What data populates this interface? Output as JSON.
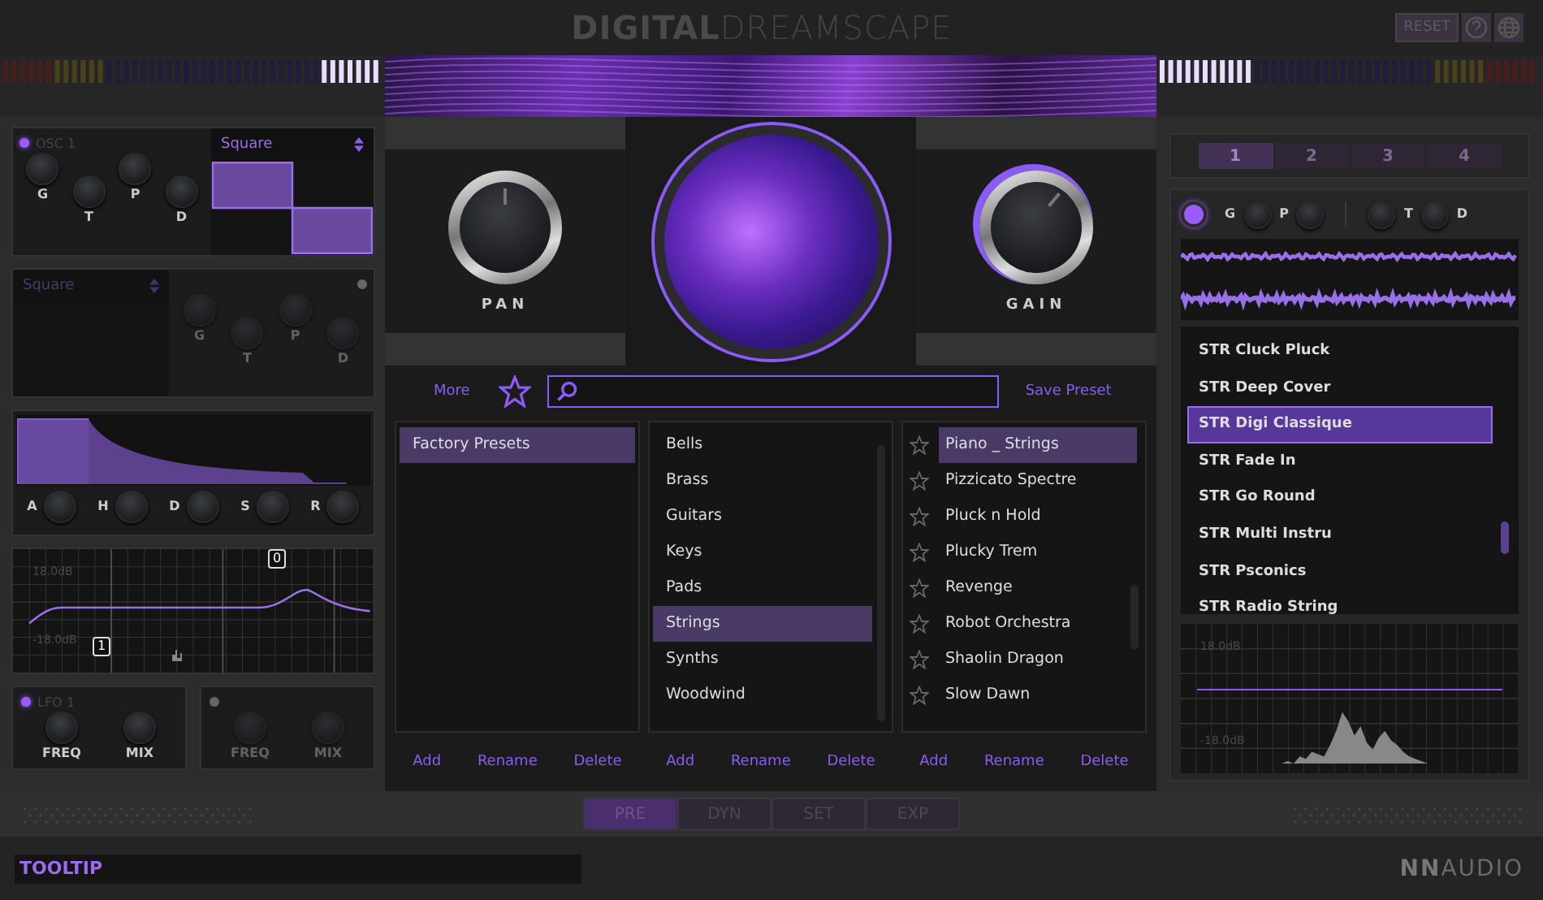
{
  "header": {
    "title": "**DIGITAL**DREAMSCAPE",
    "reset": "RESET"
  },
  "meters": [
    {
      "level": 0.16
    },
    {
      "level": 0.25
    }
  ],
  "osc1": {
    "title": "OSC 1",
    "on": true,
    "waveform": "Square",
    "knobs": [
      "G",
      "T",
      "P",
      "D"
    ]
  },
  "osc2": {
    "on": false,
    "waveform": "Square",
    "knobs": [
      "G",
      "T",
      "P",
      "D"
    ]
  },
  "envelope": {
    "knobs": [
      "A",
      "H",
      "D",
      "S",
      "R"
    ]
  },
  "eq": {
    "top_label": "18.0dB",
    "bottom_label": "-18.0dB",
    "bands": [
      "0",
      "1"
    ]
  },
  "lfos": [
    {
      "title": "LFO 1",
      "on": true,
      "knobs": [
        "FREQ",
        "MIX"
      ]
    },
    {
      "on": false,
      "knobs": [
        "FREQ",
        "MIX"
      ]
    }
  ],
  "main_knobs": {
    "left": "PAN",
    "right": "GAIN"
  },
  "browser": {
    "more": "More",
    "save": "Save Preset",
    "banks": [
      {
        "label": "Factory Presets",
        "selected": true
      }
    ],
    "categories": [
      {
        "label": "Bells",
        "selected": false
      },
      {
        "label": "Brass",
        "selected": false
      },
      {
        "label": "Guitars",
        "selected": false
      },
      {
        "label": "Keys",
        "selected": false
      },
      {
        "label": "Pads",
        "selected": false
      },
      {
        "label": "Strings",
        "selected": true
      },
      {
        "label": "Synths",
        "selected": false
      },
      {
        "label": "Woodwind",
        "selected": false
      }
    ],
    "presets": [
      {
        "label": "Piano _ Strings",
        "selected": true,
        "favorite": false
      },
      {
        "label": "Pizzicato Spectre",
        "selected": false,
        "favorite": false
      },
      {
        "label": "Pluck n Hold",
        "selected": false,
        "favorite": false
      },
      {
        "label": "Plucky Trem",
        "selected": false,
        "favorite": false
      },
      {
        "label": "Revenge",
        "selected": false,
        "favorite": false
      },
      {
        "label": "Robot Orchestra",
        "selected": false,
        "favorite": false
      },
      {
        "label": "Shaolin Dragon",
        "selected": false,
        "favorite": false
      },
      {
        "label": "Slow Dawn",
        "selected": false,
        "favorite": false
      }
    ],
    "actions": [
      [
        "Add",
        "Rename",
        "Delete"
      ],
      [
        "Add",
        "Rename",
        "Delete"
      ],
      [
        "Add",
        "Rename",
        "Delete"
      ]
    ]
  },
  "slots": [
    {
      "label": "1",
      "selected": true
    },
    {
      "label": "2",
      "selected": false
    },
    {
      "label": "3",
      "selected": false
    },
    {
      "label": "4",
      "selected": false
    }
  ],
  "sampler": {
    "on": true,
    "knobs": [
      "G",
      "P",
      "T",
      "D"
    ]
  },
  "samples": [
    {
      "label": "STR Cluck Pluck",
      "selected": false
    },
    {
      "label": "STR Deep Cover",
      "selected": false
    },
    {
      "label": "STR Digi Classique",
      "selected": true
    },
    {
      "label": "STR Fade In",
      "selected": false
    },
    {
      "label": "STR Go Round",
      "selected": false
    },
    {
      "label": "STR Multi Instru",
      "selected": false
    },
    {
      "label": "STR Psconics",
      "selected": false
    },
    {
      "label": "STR Radio String",
      "selected": false
    }
  ],
  "spectrum": {
    "top_label": "18.0dB",
    "bottom_label": "-18.0dB"
  },
  "pages": [
    {
      "label": "PRE",
      "selected": true
    },
    {
      "label": "DYN",
      "selected": false
    },
    {
      "label": "SET",
      "selected": false
    },
    {
      "label": "EXP",
      "selected": false
    }
  ],
  "tooltip": "TOOLTIP",
  "brand": "**NN**AUDIO"
}
